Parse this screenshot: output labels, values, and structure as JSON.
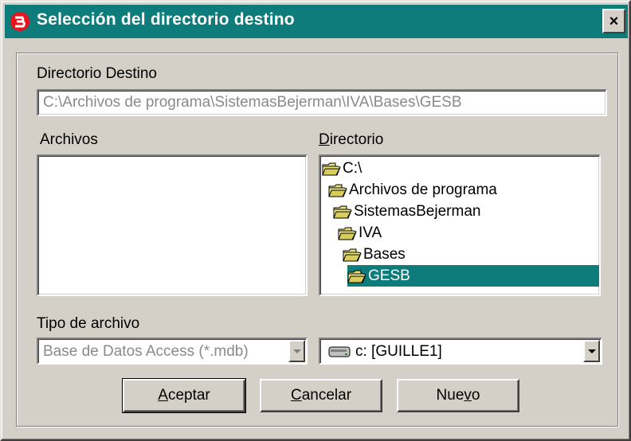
{
  "window": {
    "title": "Selección del directorio destino",
    "close_label": "×"
  },
  "destination": {
    "label": "Directorio Destino",
    "value": "C:\\Archivos de programa\\SistemasBejerman\\IVA\\Bases\\GESB"
  },
  "files": {
    "label": "Archivos",
    "items": []
  },
  "directory": {
    "label_accel": "D",
    "label_rest": "irectorio",
    "items": [
      {
        "label": "C:\\",
        "selected": false
      },
      {
        "label": "Archivos de programa",
        "selected": false
      },
      {
        "label": "SistemasBejerman",
        "selected": false
      },
      {
        "label": "IVA",
        "selected": false
      },
      {
        "label": "Bases",
        "selected": false
      },
      {
        "label": "GESB",
        "selected": true
      }
    ]
  },
  "file_type": {
    "label": "Tipo de archivo",
    "selected": "Base de Datos Access (*.mdb)"
  },
  "drive": {
    "selected": "c: [GUILLE1]",
    "icon": "drive-icon"
  },
  "buttons": {
    "accept_accel": "A",
    "accept_rest": "ceptar",
    "cancel_accel": "C",
    "cancel_rest": "ancelar",
    "new_pre": "Nue",
    "new_accel": "v",
    "new_post": "o"
  },
  "colors": {
    "titlebar": "#0e7c7b",
    "selection": "#0e7c7b",
    "face": "#d4d0c8"
  }
}
